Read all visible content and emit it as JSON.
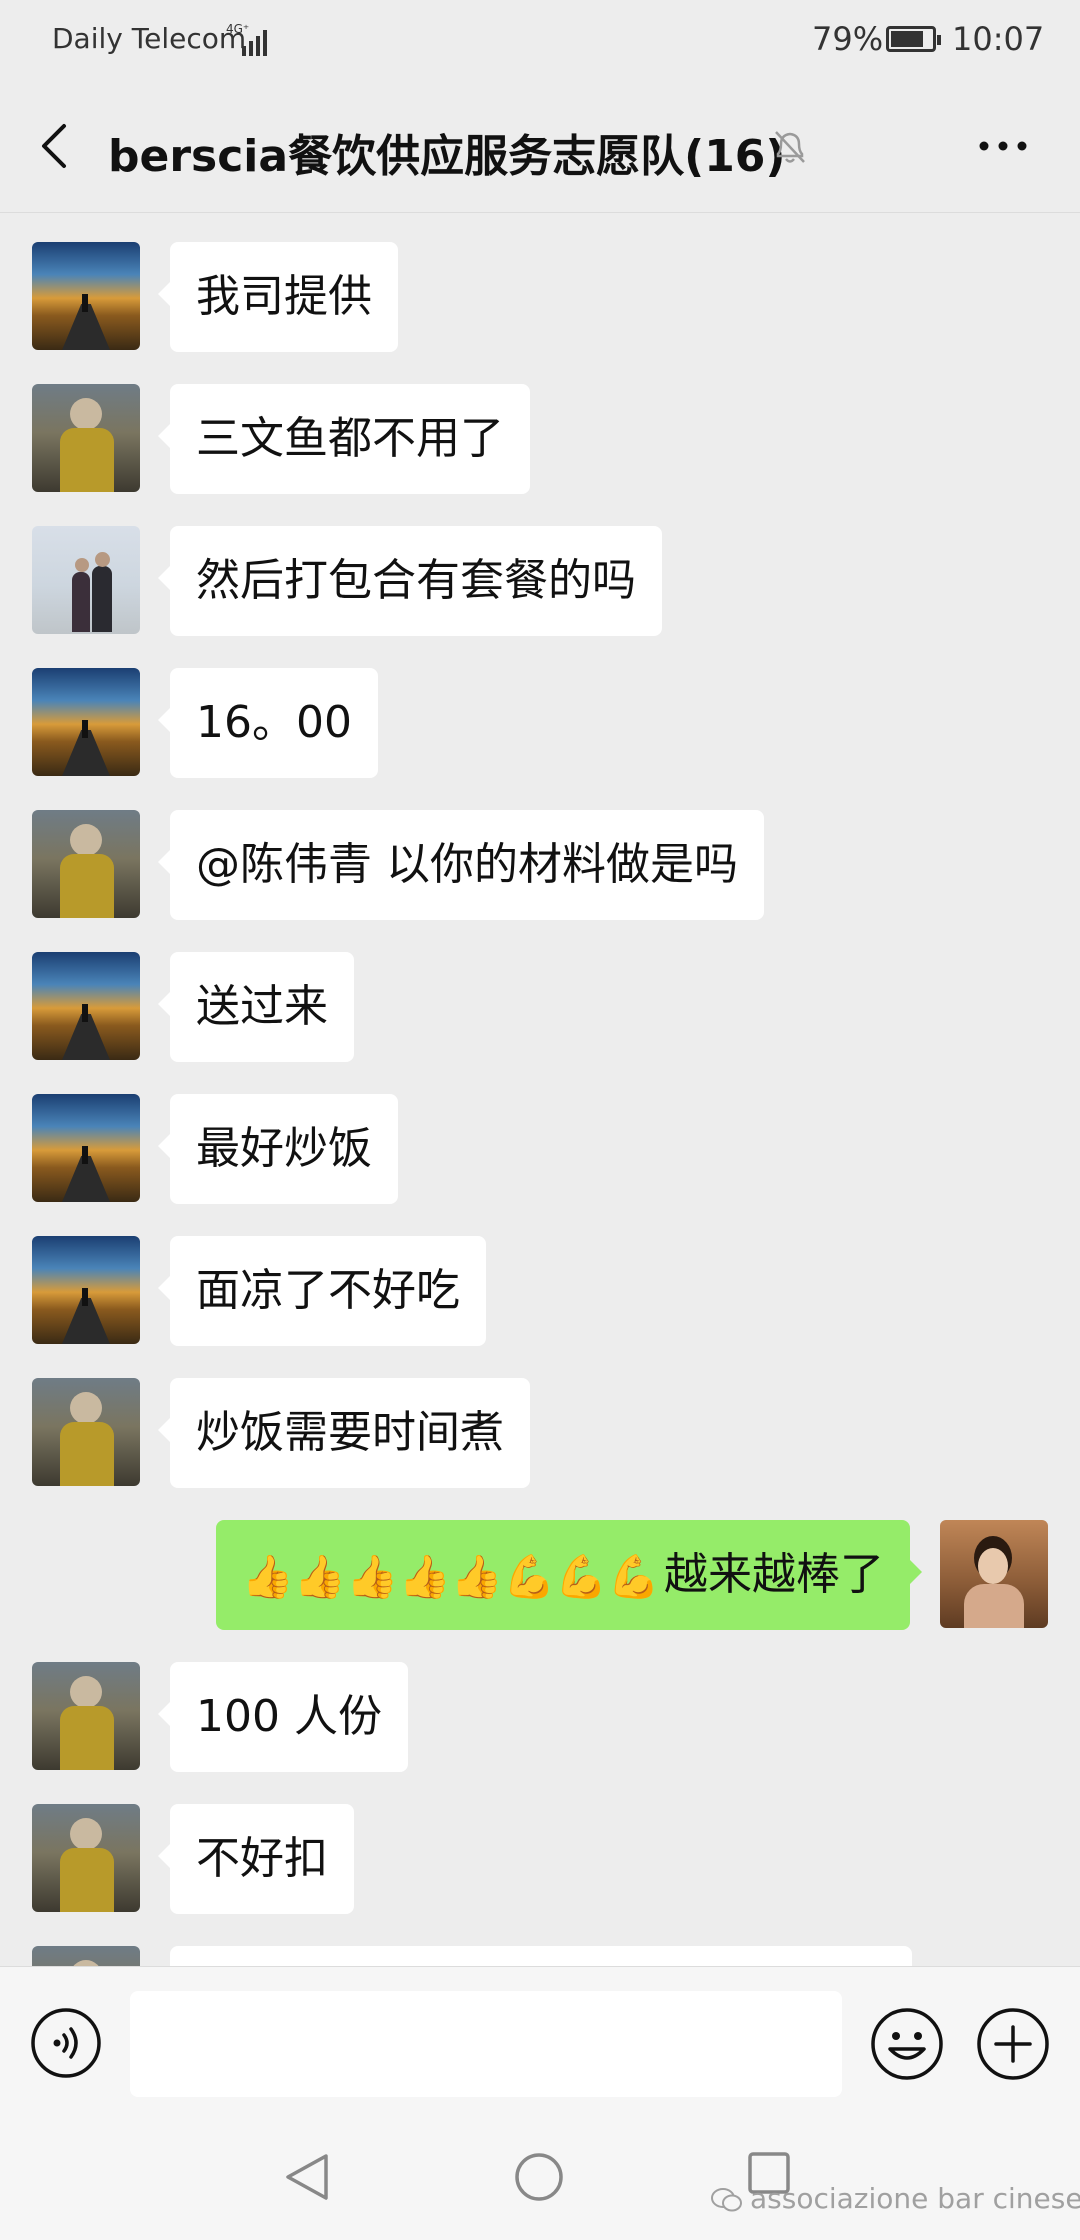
{
  "status_bar": {
    "carrier": "Daily Telecom",
    "network": "4G⁺",
    "battery_percent": "79%",
    "battery_level": 0.79,
    "time": "10:07"
  },
  "header": {
    "title": "berscia餐饮供应服务志愿队(16)",
    "icons": [
      "back-arrow-icon",
      "mute-bell-icon",
      "more-icon"
    ]
  },
  "messages": [
    {
      "side": "left",
      "avatar": "road",
      "text": "我司提供"
    },
    {
      "side": "left",
      "avatar": "child",
      "text": "三文鱼都不用了"
    },
    {
      "side": "left",
      "avatar": "couple",
      "text": "然后打包合有套餐的吗"
    },
    {
      "side": "left",
      "avatar": "road",
      "text": "16。00"
    },
    {
      "side": "left",
      "avatar": "child",
      "text": "@陈伟青  以你的材料做是吗"
    },
    {
      "side": "left",
      "avatar": "road",
      "text": "送过来"
    },
    {
      "side": "left",
      "avatar": "road",
      "text": "最好炒饭"
    },
    {
      "side": "left",
      "avatar": "road",
      "text": "面凉了不好吃"
    },
    {
      "side": "left",
      "avatar": "child",
      "text": "炒饭需要时间煮"
    },
    {
      "side": "right",
      "avatar": "woman",
      "emojis": [
        "👍",
        "👍",
        "👍",
        "👍",
        "👍",
        "💪",
        "💪",
        "💪"
      ],
      "text": "越来越棒了"
    },
    {
      "side": "left",
      "avatar": "child",
      "text": "100 人份"
    },
    {
      "side": "left",
      "avatar": "child",
      "text": "不好扣"
    }
  ],
  "input_bar": {
    "value": "",
    "icons": [
      "voice-icon",
      "emoji-icon",
      "plus-icon"
    ]
  },
  "nav_bar": {
    "icons": [
      "nav-back-icon",
      "nav-home-icon",
      "nav-recent-icon"
    ],
    "watermark": "associazione bar cinese"
  },
  "colors": {
    "background": "#ededed",
    "bubble_self": "#95ec69",
    "bubble_other": "#ffffff"
  }
}
